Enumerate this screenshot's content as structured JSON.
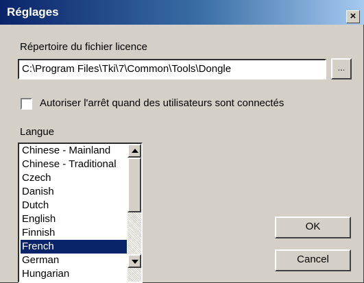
{
  "window": {
    "title": "Réglages",
    "close_glyph": "×"
  },
  "license": {
    "label": "Répertoire du fichier licence",
    "path_value": "C:\\Program Files\\Tki\\7\\Common\\Tools\\Dongle",
    "browse_label": "..."
  },
  "allow_shutdown": {
    "label": "Autoriser l'arrêt quand des utilisateurs sont connectés",
    "checked": false
  },
  "language": {
    "label": "Langue",
    "items": [
      "Chinese - Mainland",
      "Chinese - Traditional",
      "Czech",
      "Danish",
      "Dutch",
      "English",
      "Finnish",
      "French",
      "German",
      "Hungarian"
    ],
    "selected": "French"
  },
  "buttons": {
    "ok": "OK",
    "cancel": "Cancel"
  },
  "icons": {
    "close": "close-icon",
    "scroll_up": "scroll-up-arrow-icon",
    "scroll_down": "scroll-down-arrow-icon"
  },
  "colors": {
    "titlebar_start": "#0a246a",
    "titlebar_end": "#a6caf0",
    "dialog_face": "#d4d0c8",
    "selection": "#0a246a"
  }
}
